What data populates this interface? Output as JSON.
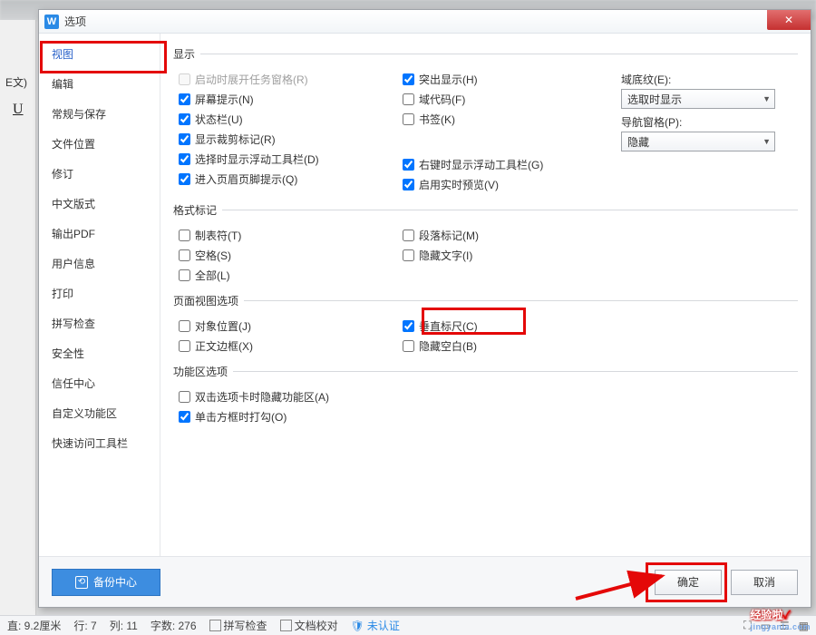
{
  "dialog": {
    "title": "选项",
    "icon_letter": "W",
    "close": "✕"
  },
  "sidebar": {
    "items": [
      {
        "label": "视图"
      },
      {
        "label": "编辑"
      },
      {
        "label": "常规与保存"
      },
      {
        "label": "文件位置"
      },
      {
        "label": "修订"
      },
      {
        "label": "中文版式"
      },
      {
        "label": "输出PDF"
      },
      {
        "label": "用户信息"
      },
      {
        "label": "打印"
      },
      {
        "label": "拼写检查"
      },
      {
        "label": "安全性"
      },
      {
        "label": "信任中心"
      },
      {
        "label": "自定义功能区"
      },
      {
        "label": "快速访问工具栏"
      }
    ]
  },
  "groups": {
    "display": {
      "title": "显示",
      "left": [
        {
          "label": "启动时展开任务窗格(R)",
          "checked": false,
          "disabled": true
        },
        {
          "label": "屏幕提示(N)",
          "checked": true
        },
        {
          "label": "状态栏(U)",
          "checked": true
        },
        {
          "label": "显示裁剪标记(R)",
          "checked": true
        },
        {
          "label": "选择时显示浮动工具栏(D)",
          "checked": true
        },
        {
          "label": "进入页眉页脚提示(Q)",
          "checked": true
        }
      ],
      "mid": [
        {
          "label": "突出显示(H)",
          "checked": true
        },
        {
          "label": "域代码(F)",
          "checked": false
        },
        {
          "label": "书签(K)",
          "checked": false
        },
        {
          "label": "右键时显示浮动工具栏(G)",
          "checked": true
        },
        {
          "label": "启用实时预览(V)",
          "checked": true
        }
      ],
      "right": [
        {
          "label": "域底纹(E):",
          "value": "选取时显示"
        },
        {
          "label": "导航窗格(P):",
          "value": "隐藏"
        }
      ]
    },
    "marks": {
      "title": "格式标记",
      "left": [
        {
          "label": "制表符(T)",
          "checked": false
        },
        {
          "label": "空格(S)",
          "checked": false
        },
        {
          "label": "全部(L)",
          "checked": false
        }
      ],
      "mid": [
        {
          "label": "段落标记(M)",
          "checked": false
        },
        {
          "label": "隐藏文字(I)",
          "checked": false
        }
      ]
    },
    "pageview": {
      "title": "页面视图选项",
      "left": [
        {
          "label": "对象位置(J)",
          "checked": false
        },
        {
          "label": "正文边框(X)",
          "checked": false
        }
      ],
      "mid": [
        {
          "label": "垂直标尺(C)",
          "checked": true
        },
        {
          "label": "隐藏空白(B)",
          "checked": false
        }
      ]
    },
    "ribbon": {
      "title": "功能区选项",
      "left": [
        {
          "label": "双击选项卡时隐藏功能区(A)",
          "checked": false
        },
        {
          "label": "单击方框时打勾(O)",
          "checked": true
        }
      ]
    }
  },
  "footer": {
    "backup": "备份中心",
    "ok": "确定",
    "cancel": "取消"
  },
  "sidepanel": {
    "fmt": "E文)",
    "u": "U"
  },
  "statusbar": {
    "dim": "直: 9.2厘米",
    "row": "行: 7",
    "col": "列: 11",
    "words": "字数: 276",
    "spell": "拼写检查",
    "proof": "文档校对",
    "auth": "未认证"
  },
  "watermark": {
    "t": "经验啦",
    "u": "jingyanla.com"
  }
}
